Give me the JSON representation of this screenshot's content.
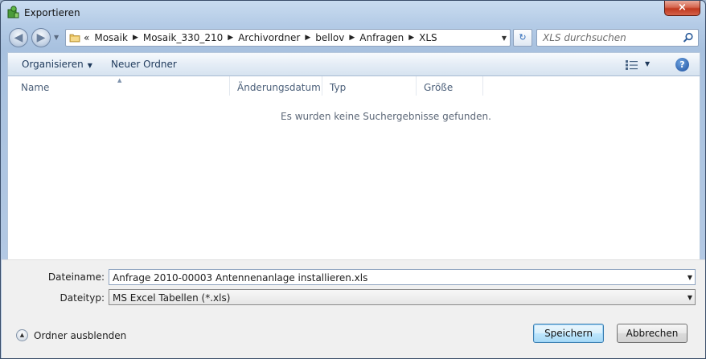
{
  "window": {
    "title": "Exportieren"
  },
  "address_bar": {
    "lead": "«",
    "crumbs": [
      "Mosaik",
      "Mosaik_330_210",
      "Archivordner",
      "bellov",
      "Anfragen",
      "XLS"
    ]
  },
  "search": {
    "placeholder": "XLS durchsuchen"
  },
  "toolbar": {
    "organize_label": "Organisieren",
    "new_folder_label": "Neuer Ordner"
  },
  "columns": [
    "Name",
    "Änderungsdatum",
    "Typ",
    "Größe"
  ],
  "list": {
    "empty_message": "Es wurden keine Suchergebnisse gefunden."
  },
  "form": {
    "filename_label": "Dateiname:",
    "filename_value": "Anfrage 2010-00003 Antennenanlage installieren.xls",
    "filetype_label": "Dateityp:",
    "filetype_value": "MS Excel Tabellen (*.xls)"
  },
  "footer": {
    "hide_folders_label": "Ordner ausblenden",
    "save_label": "Speichern",
    "cancel_label": "Abbrechen"
  },
  "icons": {
    "close": "×",
    "back": "◀",
    "forward": "▶",
    "refresh": "↻",
    "help": "?",
    "dropdown": "▼",
    "separator": "▶",
    "hide": "▲",
    "sort": "▲"
  },
  "colors": {
    "accent": "#1e395b",
    "close_button": "#c0391f"
  }
}
